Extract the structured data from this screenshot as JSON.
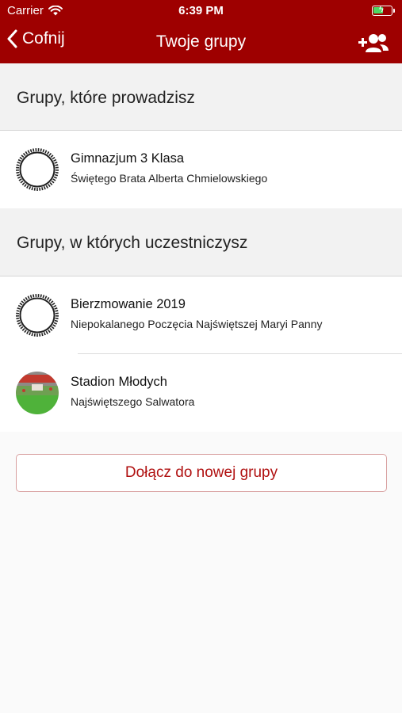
{
  "status_bar": {
    "carrier": "Carrier",
    "time": "6:39 PM"
  },
  "nav": {
    "back_label": "Cofnij",
    "title": "Twoje grupy",
    "action_icon": "add-user-icon"
  },
  "sections": {
    "led": {
      "title": "Grupy, które prowadzisz"
    },
    "joined": {
      "title": "Grupy, w których uczestniczysz"
    }
  },
  "groups": {
    "led": [
      {
        "name": "Gimnazjum 3 Klasa",
        "parish": "Świętego Brata Alberta Chmielowskiego"
      }
    ],
    "joined": [
      {
        "name": "Bierzmowanie 2019",
        "parish": "Niepokalanego Poczęcia Najświętszej Maryi Panny"
      },
      {
        "name": "Stadion Młodych",
        "parish": "Najświętszego Salwatora"
      }
    ]
  },
  "join_button": {
    "label": "Dołącz do nowej grupy"
  },
  "colors": {
    "brand": "#9e0000",
    "button_text": "#b01010",
    "battery": "#4cd964"
  }
}
